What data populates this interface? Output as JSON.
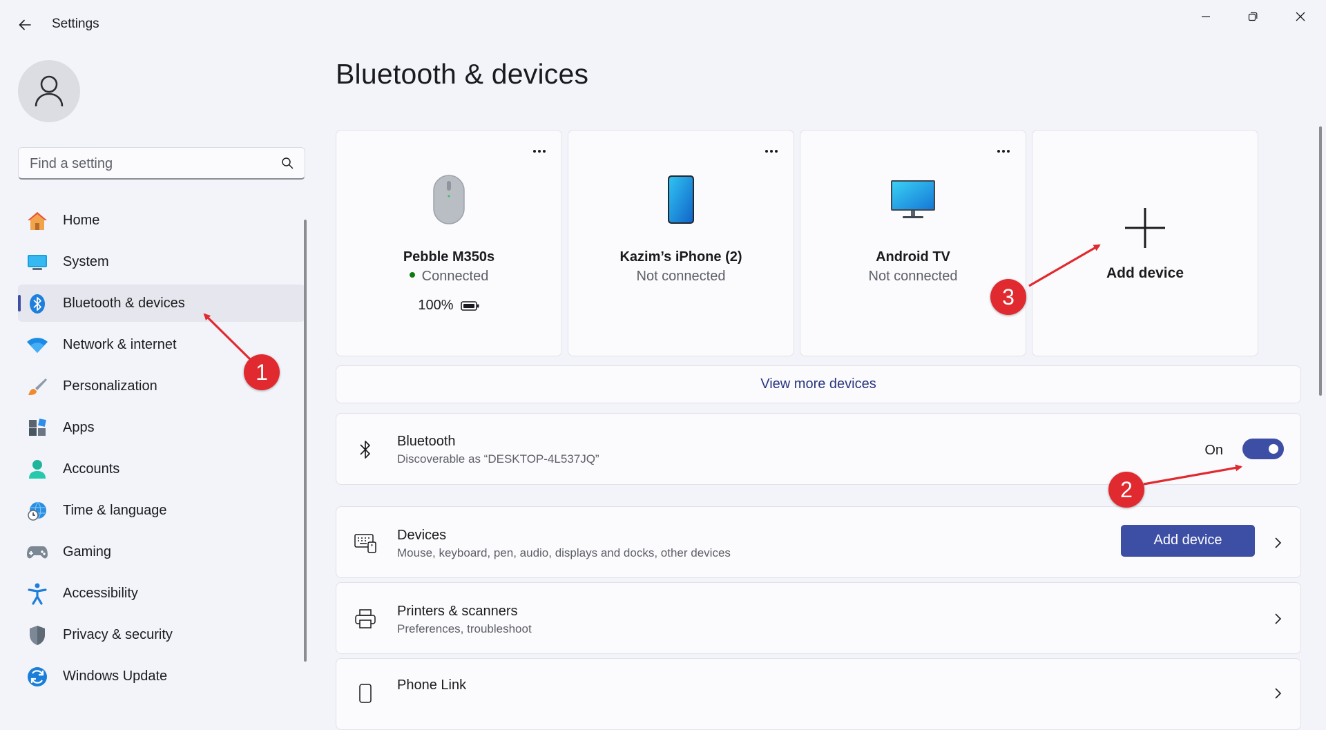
{
  "window": {
    "title": "Settings"
  },
  "search": {
    "placeholder": "Find a setting"
  },
  "sidebar": {
    "items": [
      {
        "label": "Home",
        "icon": "home-icon"
      },
      {
        "label": "System",
        "icon": "system-icon"
      },
      {
        "label": "Bluetooth & devices",
        "icon": "bluetooth-icon",
        "selected": true
      },
      {
        "label": "Network & internet",
        "icon": "wifi-icon"
      },
      {
        "label": "Personalization",
        "icon": "brush-icon"
      },
      {
        "label": "Apps",
        "icon": "apps-icon"
      },
      {
        "label": "Accounts",
        "icon": "accounts-icon"
      },
      {
        "label": "Time & language",
        "icon": "globe-clock-icon"
      },
      {
        "label": "Gaming",
        "icon": "gamepad-icon"
      },
      {
        "label": "Accessibility",
        "icon": "accessibility-icon"
      },
      {
        "label": "Privacy & security",
        "icon": "shield-icon"
      },
      {
        "label": "Windows Update",
        "icon": "update-icon"
      }
    ]
  },
  "main": {
    "title": "Bluetooth & devices",
    "devices": [
      {
        "name": "Pebble M350s",
        "status": "Connected",
        "battery": "100%",
        "icon": "mouse-icon"
      },
      {
        "name": "Kazim’s iPhone (2)",
        "status": "Not connected",
        "icon": "phone-icon"
      },
      {
        "name": "Android TV",
        "status": "Not connected",
        "icon": "monitor-icon"
      }
    ],
    "add_card_label": "Add device",
    "view_more": "View more devices",
    "bluetooth": {
      "title": "Bluetooth",
      "subtitle": "Discoverable as “DESKTOP-4L537JQ”",
      "toggle_label": "On",
      "toggle_on": true
    },
    "devices_row": {
      "title": "Devices",
      "subtitle": "Mouse, keyboard, pen, audio, displays and docks, other devices",
      "button": "Add device"
    },
    "printers_row": {
      "title": "Printers & scanners",
      "subtitle": "Preferences, troubleshoot"
    },
    "phone_row": {
      "title": "Phone Link"
    }
  },
  "annotations": [
    "1",
    "2",
    "3"
  ],
  "colors": {
    "accent": "#3d4ea5",
    "annotation": "#e02a2f",
    "link": "#283581"
  }
}
